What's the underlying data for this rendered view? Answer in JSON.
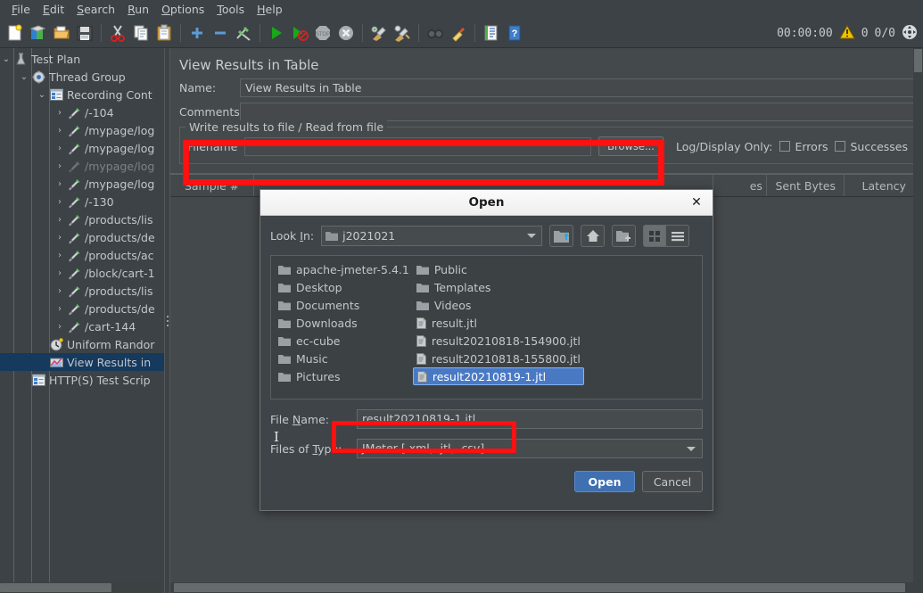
{
  "menubar": {
    "items": [
      {
        "label": "File",
        "mnemonic": "F"
      },
      {
        "label": "Edit",
        "mnemonic": "E"
      },
      {
        "label": "Search",
        "mnemonic": "S"
      },
      {
        "label": "Run",
        "mnemonic": "R"
      },
      {
        "label": "Options",
        "mnemonic": "O"
      },
      {
        "label": "Tools",
        "mnemonic": "T"
      },
      {
        "label": "Help",
        "mnemonic": "H"
      }
    ]
  },
  "toolbar": {
    "buttons": [
      {
        "name": "new-icon"
      },
      {
        "name": "templates-icon"
      },
      {
        "name": "open-icon"
      },
      {
        "name": "save-icon"
      },
      {
        "sep": true
      },
      {
        "name": "cut-icon"
      },
      {
        "name": "copy-icon"
      },
      {
        "name": "paste-icon"
      },
      {
        "sep": true
      },
      {
        "name": "expand-all-icon"
      },
      {
        "name": "collapse-all-icon"
      },
      {
        "name": "toggle-icon"
      },
      {
        "sep": true
      },
      {
        "name": "start-icon"
      },
      {
        "name": "start-no-timers-icon"
      },
      {
        "name": "stop-icon"
      },
      {
        "name": "shutdown-icon"
      },
      {
        "sep": true
      },
      {
        "name": "clear-icon"
      },
      {
        "name": "clear-all-icon"
      },
      {
        "sep": true
      },
      {
        "name": "search-icon"
      },
      {
        "name": "reset-search-icon"
      },
      {
        "sep": true
      },
      {
        "name": "function-helper-icon"
      },
      {
        "name": "help-icon"
      }
    ],
    "elapsed_time": "00:00:00",
    "warning_count": "0",
    "thread_counts": "0/0"
  },
  "tree": {
    "nodes": [
      {
        "depth": 0,
        "arrow": "⌄",
        "icon": "test-plan-icon",
        "label": "Test Plan"
      },
      {
        "depth": 1,
        "arrow": "⌄",
        "icon": "thread-group-icon",
        "label": "Thread Group"
      },
      {
        "depth": 2,
        "arrow": "⌄",
        "icon": "recording-controller-icon",
        "label": "Recording Cont"
      },
      {
        "depth": 3,
        "arrow": "›",
        "icon": "http-sampler-icon",
        "label": "/-104"
      },
      {
        "depth": 3,
        "arrow": "›",
        "icon": "http-sampler-icon",
        "label": "/mypage/log"
      },
      {
        "depth": 3,
        "arrow": "›",
        "icon": "http-sampler-icon",
        "label": "/mypage/log"
      },
      {
        "depth": 3,
        "arrow": "›",
        "icon": "http-sampler-disabled-icon",
        "label": "/mypage/log",
        "disabled": true
      },
      {
        "depth": 3,
        "arrow": "›",
        "icon": "http-sampler-icon",
        "label": "/mypage/log"
      },
      {
        "depth": 3,
        "arrow": "›",
        "icon": "http-sampler-icon",
        "label": "/-130"
      },
      {
        "depth": 3,
        "arrow": "›",
        "icon": "http-sampler-icon",
        "label": "/products/lis"
      },
      {
        "depth": 3,
        "arrow": "›",
        "icon": "http-sampler-icon",
        "label": "/products/de"
      },
      {
        "depth": 3,
        "arrow": "›",
        "icon": "http-sampler-icon",
        "label": "/products/ac"
      },
      {
        "depth": 3,
        "arrow": "›",
        "icon": "http-sampler-icon",
        "label": "/block/cart-1"
      },
      {
        "depth": 3,
        "arrow": "›",
        "icon": "http-sampler-icon",
        "label": "/products/lis"
      },
      {
        "depth": 3,
        "arrow": "›",
        "icon": "http-sampler-icon",
        "label": "/products/de"
      },
      {
        "depth": 3,
        "arrow": "›",
        "icon": "http-sampler-icon",
        "label": "/cart-144"
      },
      {
        "depth": 2,
        "arrow": "",
        "icon": "timer-icon",
        "label": "Uniform Randor"
      },
      {
        "depth": 2,
        "arrow": "",
        "icon": "view-results-table-icon",
        "label": "View Results in",
        "selected": true
      },
      {
        "depth": 1,
        "arrow": "",
        "icon": "http-test-script-recorder-icon",
        "label": "HTTP(S) Test Scrip"
      }
    ]
  },
  "panel": {
    "title": "View Results in Table",
    "name_label": "Name:",
    "name_value": "View Results in Table",
    "comments_label": "Comments:",
    "comments_value": "",
    "group_legend": "Write results to file / Read from file",
    "filename_label": "Filename",
    "filename_value": "",
    "browse_label": "Browse...",
    "log_display_label": "Log/Display Only:",
    "errors_label": "Errors",
    "successes_label": "Successes",
    "table_columns": [
      "Sample #",
      "es",
      "Sent Bytes",
      "Latency"
    ]
  },
  "dialog": {
    "title": "Open",
    "close_icon": "✕",
    "look_in_label": "Look In:",
    "look_in_value": "j2021021",
    "toolbar_icons": [
      "up-folder-icon",
      "home-icon",
      "new-folder-icon",
      "grid-view-icon",
      "list-view-icon"
    ],
    "files": [
      {
        "name": "apache-jmeter-5.4.1",
        "type": "folder"
      },
      {
        "name": "Desktop",
        "type": "folder"
      },
      {
        "name": "Documents",
        "type": "folder"
      },
      {
        "name": "Downloads",
        "type": "folder"
      },
      {
        "name": "ec-cube",
        "type": "folder"
      },
      {
        "name": "Music",
        "type": "folder"
      },
      {
        "name": "Pictures",
        "type": "folder"
      },
      {
        "name": "Public",
        "type": "folder"
      },
      {
        "name": "Templates",
        "type": "folder"
      },
      {
        "name": "Videos",
        "type": "folder"
      },
      {
        "name": "result.jtl",
        "type": "file"
      },
      {
        "name": "result20210818-154900.jtl",
        "type": "file"
      },
      {
        "name": "result20210818-155800.jtl",
        "type": "file"
      },
      {
        "name": "result20210819-1.jtl",
        "type": "file",
        "selected": true
      }
    ],
    "file_name_label": "File Name:",
    "file_name_mnemonic": "N",
    "file_name_value": "result20210819-1.jtl",
    "files_of_type_label": "Files of Type:",
    "files_of_type_mnemonic": "T",
    "files_of_type_value": "JMeter [.xml, .jtl, .csv]",
    "open_button": "Open",
    "cancel_button": "Cancel"
  },
  "colors": {
    "accent_blue": "#4a79c4",
    "highlight_red": "#fd1111",
    "selection_navy": "#16395e",
    "window_bg": "#3c4245",
    "panel_bg": "#44494c"
  }
}
